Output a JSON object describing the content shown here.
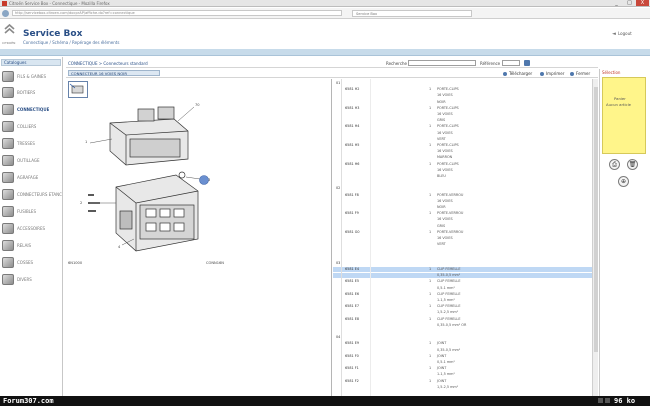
{
  "window": {
    "title": "Citroën Service Box - Connectique - Mozilla Firefox",
    "minimize": "_",
    "maximize": "□",
    "close": "X"
  },
  "browser": {
    "address": "http://servicebox.citroen.com/docprAP/affiche.do?ref=connectique",
    "tab": "Service Box"
  },
  "header": {
    "logo_sub": "CITROËN",
    "title": "Service Box",
    "subtitle": "Connectique / Schéma / Repérage des éléments",
    "logout": "Logout"
  },
  "sidebar": {
    "heading": "Catalogues",
    "items": [
      {
        "label": "FILS & GAINES"
      },
      {
        "label": "BOITIERS"
      },
      {
        "label": "CONNECTIQUE"
      },
      {
        "label": "COLLIERS"
      },
      {
        "label": "TRESSES"
      },
      {
        "label": "OUTILLAGE"
      },
      {
        "label": "AGRAFAGE"
      },
      {
        "label": "CONNECTEURS ETANCHES"
      },
      {
        "label": "FUSIBLES"
      },
      {
        "label": "ACCESSOIRES"
      },
      {
        "label": "RELAIS"
      },
      {
        "label": "COSSES"
      },
      {
        "label": "DIVERS"
      }
    ]
  },
  "toolbar": {
    "breadcrumb": "CONNECTIQUE > Connecteurs standard",
    "search_label": "Recherche",
    "ref_label": "Référence"
  },
  "viewbar": {
    "selection": "CONNECTEUR 16 VOIES NOIR",
    "download": "Télécharger",
    "print": "Imprimer",
    "close": "Fermer"
  },
  "diagram": {
    "labels": {
      "top_right": "70",
      "top_left": "1",
      "mid_left": "2",
      "mid_right": "3",
      "bottom": "4",
      "ref_left": "6N1000",
      "ref_right": "CONN16N"
    }
  },
  "table": {
    "rows": [
      {
        "group": "01",
        "ref": "",
        "qty": "",
        "desc": ""
      },
      {
        "group": "",
        "ref": "6581 H2",
        "qty": "1",
        "desc": "PORTE-CLIPS"
      },
      {
        "group": "",
        "ref": "",
        "qty": "",
        "desc": "16 VOIES"
      },
      {
        "group": "",
        "ref": "",
        "qty": "",
        "desc": "NOIR"
      },
      {
        "group": "",
        "ref": "6581 H3",
        "qty": "1",
        "desc": "PORTE-CLIPS"
      },
      {
        "group": "",
        "ref": "",
        "qty": "",
        "desc": "16 VOIES"
      },
      {
        "group": "",
        "ref": "",
        "qty": "",
        "desc": "GRIS"
      },
      {
        "group": "",
        "ref": "6581 H4",
        "qty": "1",
        "desc": "PORTE-CLIPS"
      },
      {
        "group": "",
        "ref": "",
        "qty": "",
        "desc": "16 VOIES"
      },
      {
        "group": "",
        "ref": "",
        "qty": "",
        "desc": "VERT"
      },
      {
        "group": "",
        "ref": "6581 H5",
        "qty": "1",
        "desc": "PORTE-CLIPS"
      },
      {
        "group": "",
        "ref": "",
        "qty": "",
        "desc": "16 VOIES"
      },
      {
        "group": "",
        "ref": "",
        "qty": "",
        "desc": "MARRON"
      },
      {
        "group": "",
        "ref": "6581 H6",
        "qty": "1",
        "desc": "PORTE-CLIPS"
      },
      {
        "group": "",
        "ref": "",
        "qty": "",
        "desc": "16 VOIES"
      },
      {
        "group": "",
        "ref": "",
        "qty": "",
        "desc": "BLEU"
      },
      {
        "group": "",
        "ref": "",
        "qty": "",
        "desc": ""
      },
      {
        "group": "02",
        "ref": "",
        "qty": "",
        "desc": ""
      },
      {
        "group": "",
        "ref": "6581 F8",
        "qty": "1",
        "desc": "PORTE-VERROU"
      },
      {
        "group": "",
        "ref": "",
        "qty": "",
        "desc": "16 VOIES"
      },
      {
        "group": "",
        "ref": "",
        "qty": "",
        "desc": "NOIR"
      },
      {
        "group": "",
        "ref": "6581 F9",
        "qty": "1",
        "desc": "PORTE-VERROU"
      },
      {
        "group": "",
        "ref": "",
        "qty": "",
        "desc": "16 VOIES"
      },
      {
        "group": "",
        "ref": "",
        "qty": "",
        "desc": "GRIS"
      },
      {
        "group": "",
        "ref": "6581 G0",
        "qty": "1",
        "desc": "PORTE-VERROU"
      },
      {
        "group": "",
        "ref": "",
        "qty": "",
        "desc": "16 VOIES"
      },
      {
        "group": "",
        "ref": "",
        "qty": "",
        "desc": "VERT"
      },
      {
        "group": "",
        "ref": "",
        "qty": "",
        "desc": ""
      },
      {
        "group": "",
        "ref": "",
        "qty": "",
        "desc": ""
      },
      {
        "group": "03",
        "ref": "",
        "qty": "",
        "desc": ""
      },
      {
        "group": "",
        "ref": "6581 E4",
        "qty": "1",
        "desc": "CLIP FEMELLE",
        "hl": true
      },
      {
        "group": "",
        "ref": "",
        "qty": "",
        "desc": "0,35-0,5 mm²",
        "hl": true
      },
      {
        "group": "",
        "ref": "6581 E5",
        "qty": "1",
        "desc": "CLIP FEMELLE"
      },
      {
        "group": "",
        "ref": "",
        "qty": "",
        "desc": "0,5-1 mm²"
      },
      {
        "group": "",
        "ref": "6581 E6",
        "qty": "1",
        "desc": "CLIP FEMELLE"
      },
      {
        "group": "",
        "ref": "",
        "qty": "",
        "desc": "1-1,5 mm²"
      },
      {
        "group": "",
        "ref": "6581 E7",
        "qty": "1",
        "desc": "CLIP FEMELLE"
      },
      {
        "group": "",
        "ref": "",
        "qty": "",
        "desc": "1,5-2,5 mm²"
      },
      {
        "group": "",
        "ref": "6581 E8",
        "qty": "1",
        "desc": "CLIP FEMELLE"
      },
      {
        "group": "",
        "ref": "",
        "qty": "",
        "desc": "0,35-0,5 mm² OR"
      },
      {
        "group": "",
        "ref": "",
        "qty": "",
        "desc": ""
      },
      {
        "group": "04",
        "ref": "",
        "qty": "",
        "desc": ""
      },
      {
        "group": "",
        "ref": "6581 E9",
        "qty": "1",
        "desc": "JOINT"
      },
      {
        "group": "",
        "ref": "",
        "qty": "",
        "desc": "0,35-0,5 mm²"
      },
      {
        "group": "",
        "ref": "6581 F0",
        "qty": "1",
        "desc": "JOINT"
      },
      {
        "group": "",
        "ref": "",
        "qty": "",
        "desc": "0,5-1 mm²"
      },
      {
        "group": "",
        "ref": "6581 F1",
        "qty": "1",
        "desc": "JOINT"
      },
      {
        "group": "",
        "ref": "",
        "qty": "",
        "desc": "1-1,5 mm²"
      },
      {
        "group": "",
        "ref": "6581 F2",
        "qty": "1",
        "desc": "JOINT"
      },
      {
        "group": "",
        "ref": "",
        "qty": "",
        "desc": "1,5-2,5 mm²"
      }
    ]
  },
  "rightpanel": {
    "title": "Sélection",
    "note_line1": "Panier",
    "note_line2": "Aucun article",
    "icons": [
      "print-icon",
      "trash-icon",
      "cart-icon"
    ]
  },
  "status": {
    "left": "Forum307.com",
    "right": "96 ko"
  },
  "colors": {
    "accent": "#2a4f86",
    "highlight": "#bfd8f4",
    "note": "#fff58a",
    "callout": "#6a8fd0"
  }
}
